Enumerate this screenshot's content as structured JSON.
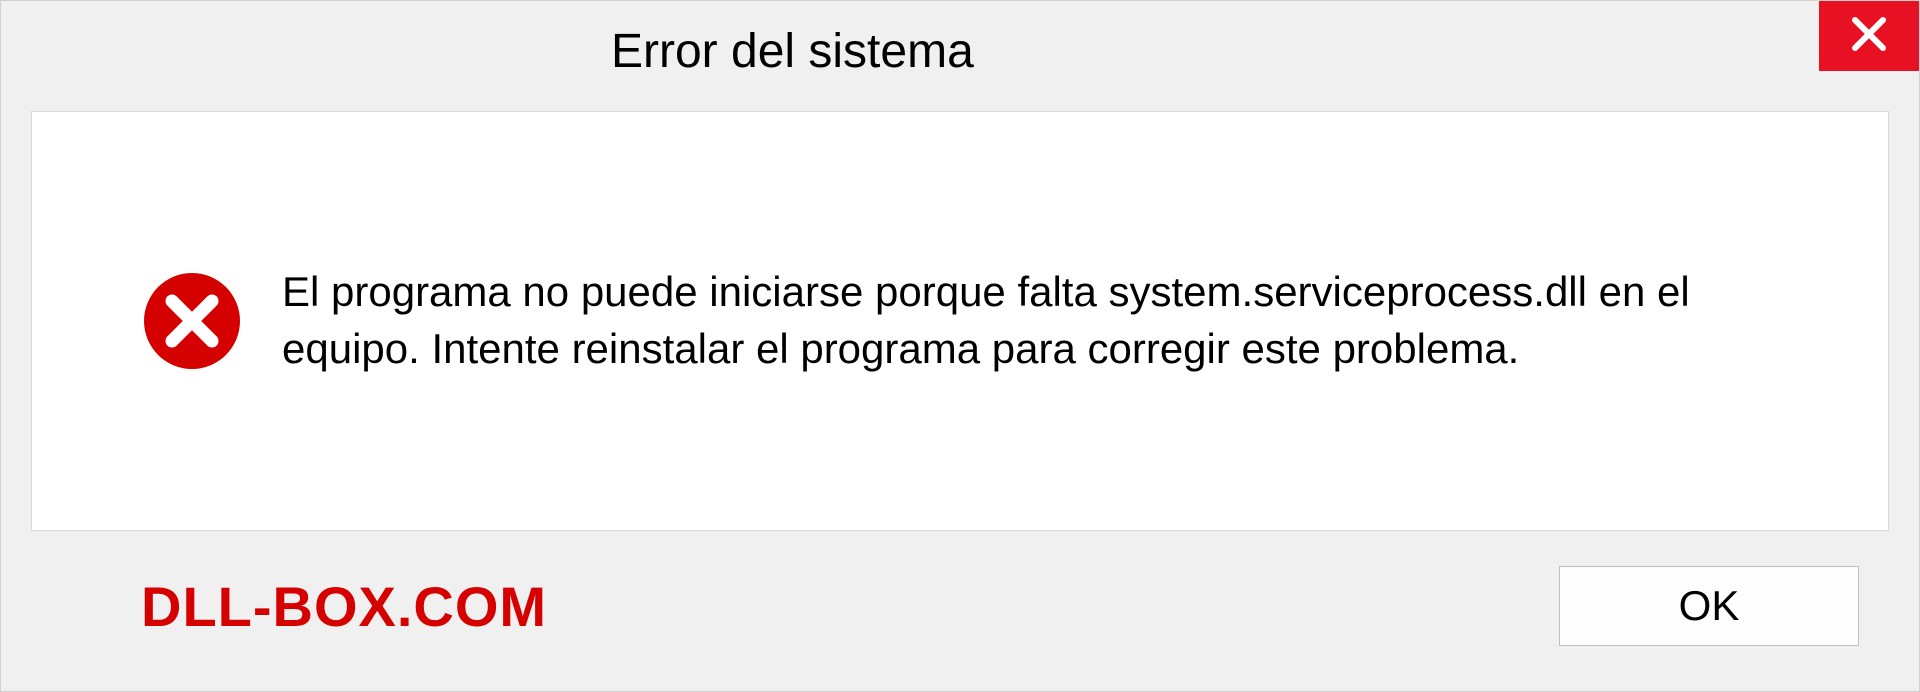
{
  "dialog": {
    "title": "Error del sistema",
    "message": "El programa no puede iniciarse porque falta system.serviceprocess.dll en el equipo. Intente reinstalar el programa para corregir este problema.",
    "ok_label": "OK",
    "watermark": "DLL-BOX.COM"
  }
}
